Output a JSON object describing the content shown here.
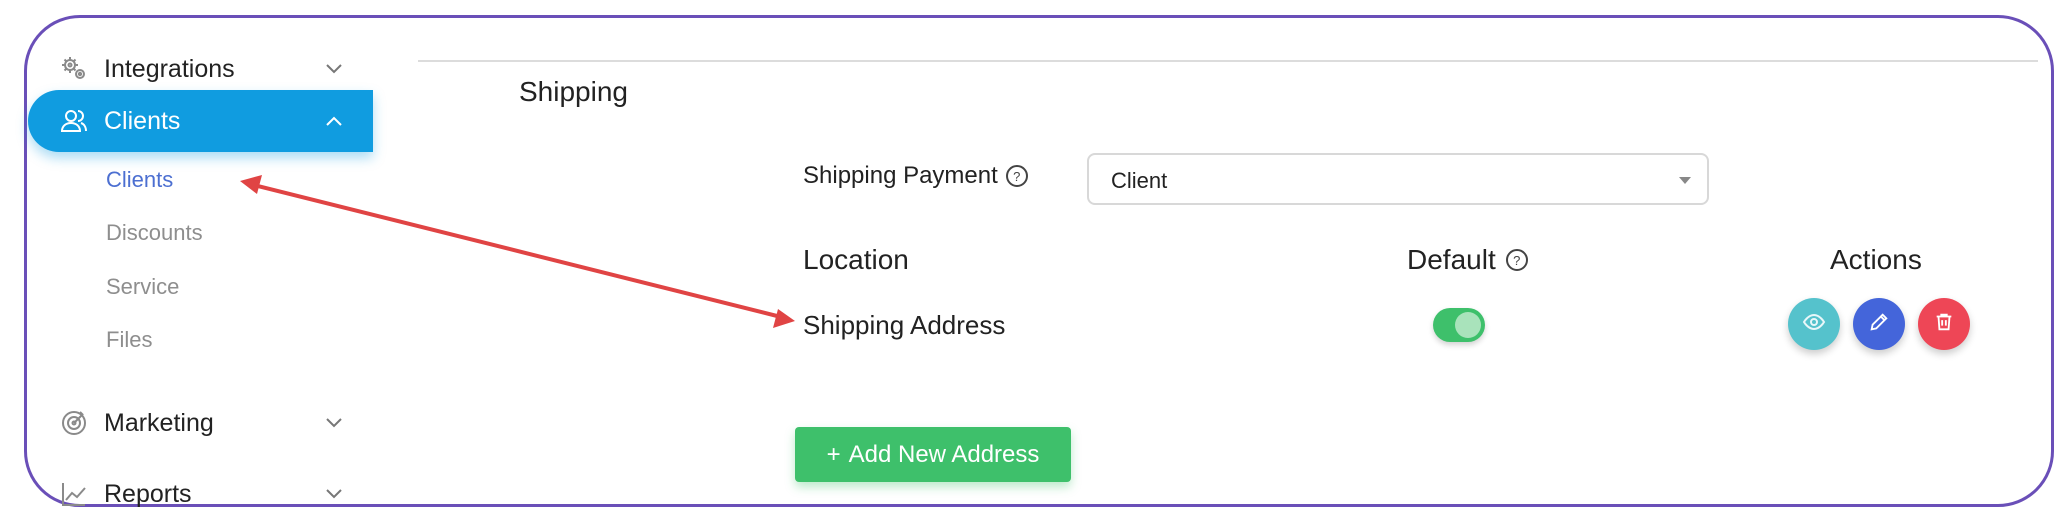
{
  "sidebar": {
    "items": [
      {
        "label": "Integrations",
        "icon": "gears-icon",
        "expanded": false
      },
      {
        "label": "Clients",
        "icon": "users-icon",
        "expanded": true,
        "active": true
      },
      {
        "label": "Marketing",
        "icon": "target-icon",
        "expanded": false
      },
      {
        "label": "Reports",
        "icon": "chart-line-icon",
        "expanded": false
      }
    ],
    "subitems": [
      {
        "label": "Clients",
        "selected": true
      },
      {
        "label": "Discounts"
      },
      {
        "label": "Service"
      },
      {
        "label": "Files"
      }
    ]
  },
  "main": {
    "section_title": "Shipping",
    "shipping_payment": {
      "label": "Shipping Payment",
      "value": "Client"
    },
    "table": {
      "headers": {
        "location": "Location",
        "default": "Default",
        "actions": "Actions"
      },
      "rows": [
        {
          "location": "Shipping Address",
          "default": true
        }
      ]
    },
    "add_button": {
      "icon": "+",
      "label": "Add New Address"
    }
  },
  "colors": {
    "accent": "#109ce0",
    "success": "#3ec06b",
    "view": "#55c2cc",
    "edit": "#4465da",
    "delete": "#ee4656",
    "annotation_arrow": "#e04444"
  }
}
